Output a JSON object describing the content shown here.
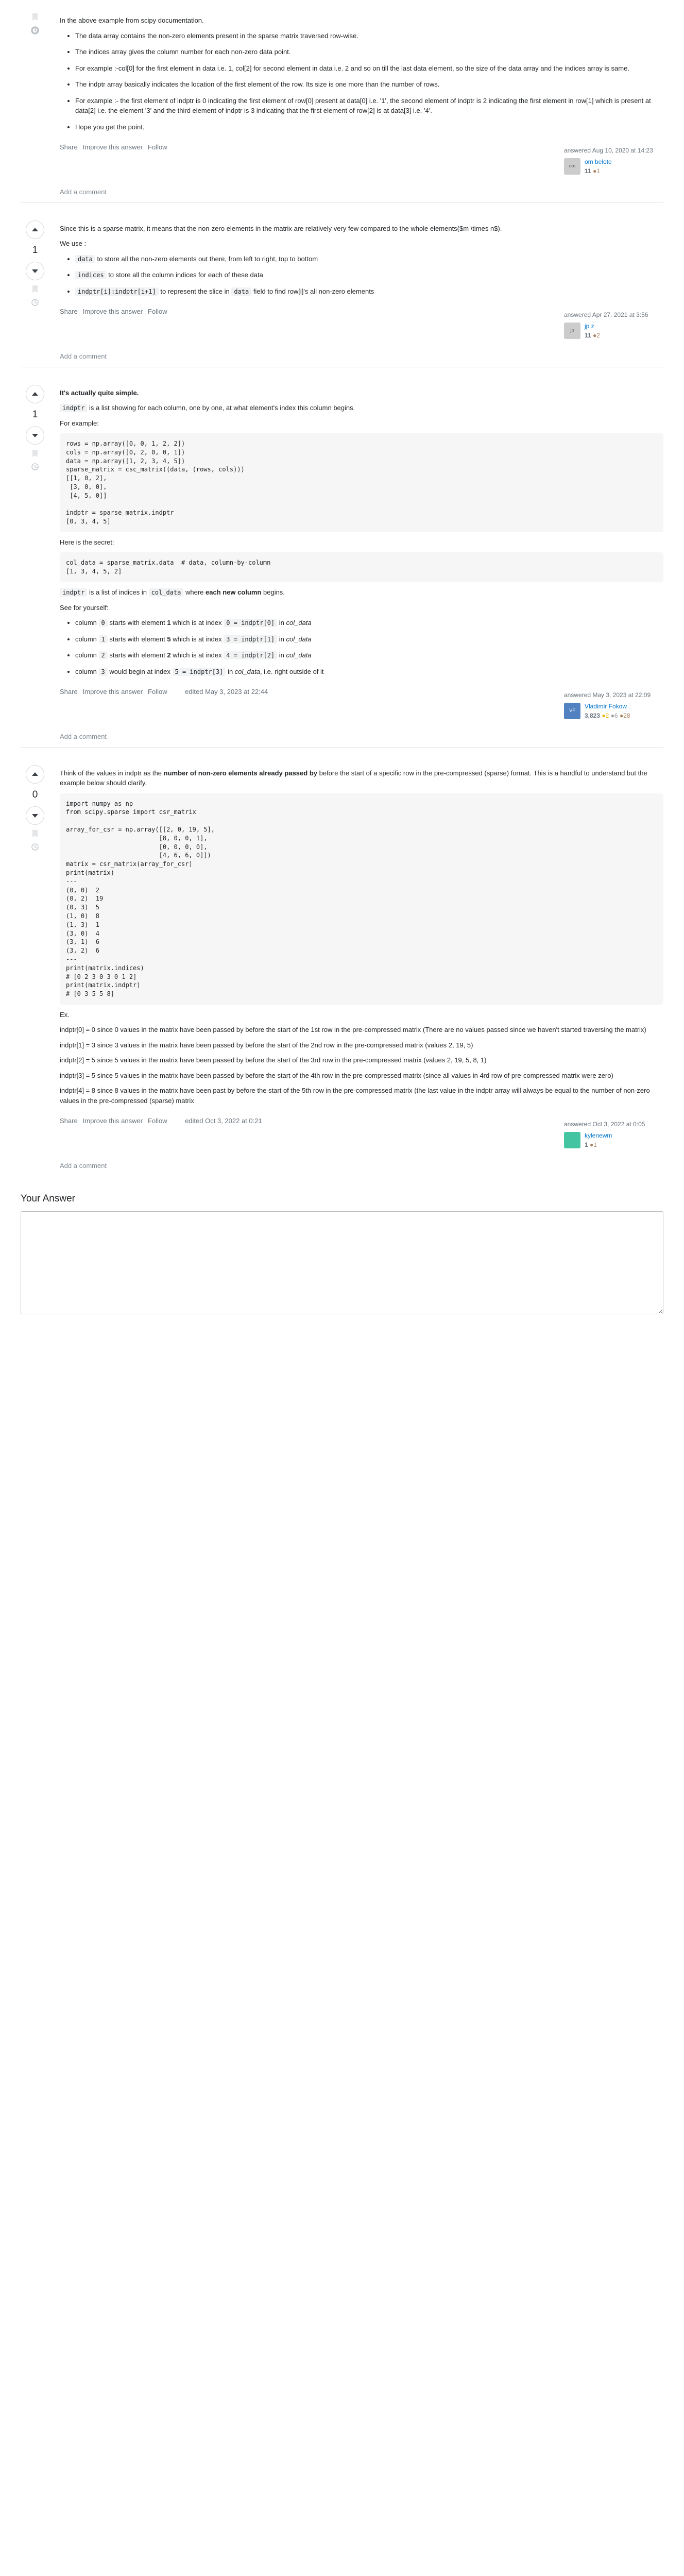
{
  "common": {
    "share": "Share",
    "improve": "Improve this answer",
    "follow": "Follow",
    "add_comment": "Add a comment"
  },
  "a1": {
    "intro": "In the above example from scipy documentation.",
    "b0": "The data array contains the non-zero elements present in the sparse matrix traversed row-wise.",
    "b1": "The indices array gives the column number for each non-zero data point.",
    "b2": "For example :-col[0] for the first element in data i.e. 1, col[2] for second element in data i.e. 2 and so on till the last data element, so the size of the data array and the indices array is same.",
    "b3": "The indptr array basically indicates the location of the first element of the row. Its size is one more than the number of rows.",
    "b4": "For example :- the first element of indptr is 0 indicating the first element of row[0] present at data[0] i.e. '1', the second element of indptr is 2 indicating the first element in row[1] which is present at data[2] i.e. the element '3' and the third element of indptr is 3 indicating that the first element of row[2] is at data[3] i.e. '4'.",
    "b5": "Hope you get the point.",
    "time": "answered Aug 10, 2020 at 14:23",
    "user": "om belote",
    "rep": "11",
    "bronze": "1"
  },
  "a2": {
    "vote": "1",
    "p0": "Since this is a sparse matrix, it means that the non-zero elements in the matrix are relatively very few compared to the whole elements($m \\times n$).",
    "p1": "We use :",
    "li0_code": "data",
    "li0_txt": " to store all the non-zero elements out there, from left to right, top to bottom",
    "li1_code": "indices",
    "li1_txt": " to store all the column indices for each of these data",
    "li2_code": "indptr[i]:indptr[i+1]",
    "li2_mid": " to represent the slice in ",
    "li2_code2": "data",
    "li2_txt": " field to find row[i]'s all non-zero elements",
    "time": "answered Apr 27, 2021 at 3:56",
    "user": "jp z",
    "rep": "11",
    "bronze": "2"
  },
  "a3": {
    "vote": "1",
    "h": "It's actually quite simple.",
    "p0a": "indptr",
    "p0b": " is a list showing for each column, one by one, at what element's index this column begins.",
    "p1": "For example:",
    "code1": "rows = np.array([0, 0, 1, 2, 2])\ncols = np.array([0, 2, 0, 0, 1])\ndata = np.array([1, 2, 3, 4, 5])\nsparse_matrix = csc_matrix((data, (rows, cols)))\n[[1, 0, 2],\n [3, 0, 0],\n [4, 5, 0]]\n\nindptr = sparse_matrix.indptr\n[0, 3, 4, 5]",
    "p2": "Here is the secret:",
    "code2": "col_data = sparse_matrix.data  # data, column-by-column\n[1, 3, 4, 5, 2]",
    "p3a": "indptr",
    "p3b": " is a list of indices in ",
    "p3c": "col_data",
    "p3d": " where ",
    "p3e": "each new column",
    "p3f": " begins.",
    "p4": "See for yourself:",
    "li0a": "column ",
    "li0b": "0",
    "li0c": " starts with element ",
    "li0d": "1",
    "li0e": " which is at index ",
    "li0f": "0 = indptr[0]",
    "li0g": " in ",
    "li0h": "col_data",
    "li1a": "column ",
    "li1b": "1",
    "li1c": " starts with element ",
    "li1d": "5",
    "li1e": " which is at index ",
    "li1f": "3 = indptr[1]",
    "li1g": " in ",
    "li1h": "col_data",
    "li2a": "column ",
    "li2b": "2",
    "li2c": " starts with element ",
    "li2d": "2",
    "li2e": " which is at index ",
    "li2f": "4 = indptr[2]",
    "li2g": " in ",
    "li2h": "col_data",
    "li3a": "column ",
    "li3b": "3",
    "li3c": " would begin at index ",
    "li3d": "5 = indptr[3]",
    "li3e": " in ",
    "li3f": "col_data",
    "li3g": ", i.e. right outside of it",
    "edited": "edited May 3, 2023 at 22:44",
    "time": "answered May 3, 2023 at 22:09",
    "user": "Vladimir Fokow",
    "rep": "3,823",
    "gold": "2",
    "silver": "6",
    "bronze": "28"
  },
  "a4": {
    "vote": "0",
    "p0a": "Think of the values in indptr as the ",
    "p0b": "number of non-zero elements already passed by",
    "p0c": " before the start of a specific row in the pre-compressed (sparse) format. This is a handful to understand but the example below should clarify.",
    "code1": "import numpy as np\nfrom scipy.sparse import csr_matrix\n\narray_for_csr = np.array([[2, 0, 19, 5],\n                         [8, 0, 0, 1],\n                         [0, 0, 0, 0],\n                         [4, 6, 6, 0]])\nmatrix = csr_matrix(array_for_csr)\nprint(matrix)\n---\n(0, 0)  2\n(0, 2)  19\n(0, 3)  5\n(1, 0)  8\n(1, 3)  1\n(3, 0)  4\n(3, 1)  6\n(3, 2)  6\n---\nprint(matrix.indices)\n# [0 2 3 0 3 0 1 2]\nprint(matrix.indptr)\n# [0 3 5 5 8]",
    "ex": "Ex.",
    "p1": "indptr[0] = 0 since 0 values in the matrix have been passed by before the start of the 1st row in the pre-compressed matrix (There are no values passed since we haven't started traversing the matrix)",
    "p2": "indptr[1] = 3 since 3 values in the matrix have been passed by before the start of the 2nd row in the pre-compressed matrix (values 2, 19, 5)",
    "p3": "indptr[2] = 5 since 5 values in the matrix have been passed by before the start of the 3rd row in the pre-compressed matrix (values 2, 19, 5, 8, 1)",
    "p4": "indptr[3] = 5 since 5 values in the matrix have been passed by before the start of the 4th row in the pre-compressed matrix (since all values in 4rd row of pre-compressed matrix were zero)",
    "p5": "indptr[4] = 8 since 8 values in the matrix have been past by before the start of the 5th row in the pre-compressed matrix (the last value in the indptr array will always be equal to the number of non-zero values in the pre-compressed (sparse) matrix",
    "edited": "edited Oct 3, 2022 at 0:21",
    "time": "answered Oct 3, 2022 at 0:05",
    "user": "kylenewm",
    "rep": "1",
    "bronze": "1"
  },
  "your_answer": "Your Answer"
}
